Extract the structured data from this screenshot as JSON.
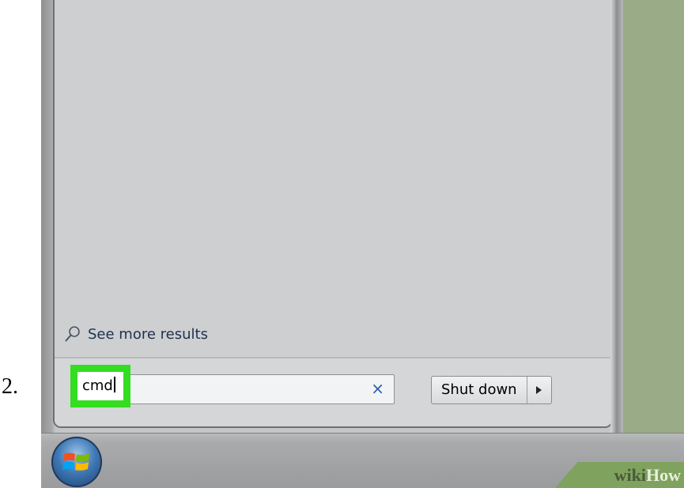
{
  "step": {
    "number": "2."
  },
  "start_menu": {
    "see_more_results": "See more results",
    "search": {
      "value": "cmd",
      "clear_glyph": "×"
    },
    "shutdown": {
      "label": "Shut down"
    }
  },
  "watermark": {
    "wiki": "wiki",
    "how": "How"
  },
  "icons": {
    "search_results": "magnifier-icon",
    "clear": "close-icon",
    "shutdown_options": "chevron-right-icon",
    "start": "windows-logo-icon"
  },
  "colors": {
    "highlight": "#33dd1f",
    "desktop": "#9aab88",
    "menu_background": "#cfd1d3",
    "clear_icon": "#2a5ca8"
  }
}
